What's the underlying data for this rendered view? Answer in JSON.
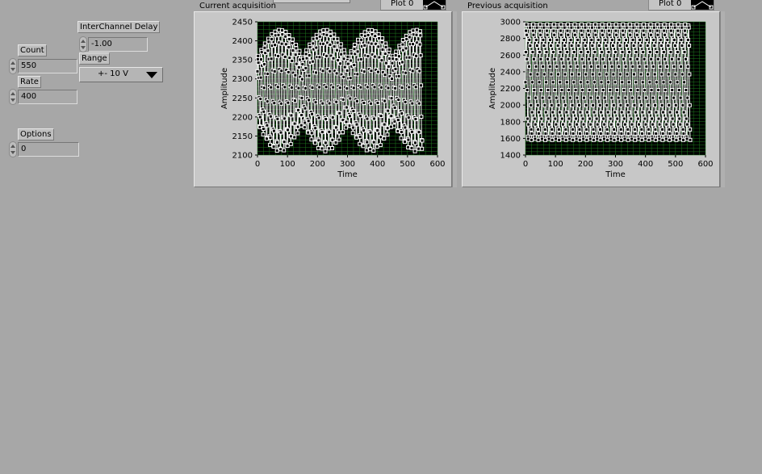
{
  "controls": {
    "interchannel_delay": {
      "label": "InterChannel Delay",
      "value": "-1.00"
    },
    "count": {
      "label": "Count",
      "value": "550"
    },
    "rate": {
      "label": "Rate",
      "value": "400"
    },
    "range": {
      "label": "Range",
      "selected": "+- 10 V"
    },
    "options": {
      "label": "Options",
      "value": "0"
    }
  },
  "graphs": [
    {
      "title": "Current acquisition",
      "legend_label": "Plot 0",
      "chart_data": {
        "type": "line",
        "xlabel": "Time",
        "ylabel": "Amplitude",
        "xlim": [
          0,
          600
        ],
        "ylim": [
          2100,
          2450
        ],
        "xticks": [
          "0",
          "100",
          "200",
          "300",
          "400",
          "500",
          "600"
        ],
        "yticks": [
          "2100",
          "2150",
          "2200",
          "2250",
          "2300",
          "2350",
          "2400",
          "2450"
        ],
        "grid": true,
        "marker": "square",
        "series": [
          {
            "x_start": 0,
            "x_end": 549,
            "n_points": 550,
            "min": 2110,
            "max": 2430,
            "pattern": "oscillating 2110–2430 with a period of about 11.5 samples"
          }
        ]
      }
    },
    {
      "title": "Previous acquisition",
      "legend_label": "Plot 0",
      "chart_data": {
        "type": "line",
        "xlabel": "Time",
        "ylabel": "Amplitude",
        "xlim": [
          0,
          600
        ],
        "ylim": [
          1400,
          3000
        ],
        "xticks": [
          "0",
          "100",
          "200",
          "300",
          "400",
          "500",
          "600"
        ],
        "yticks": [
          "1400",
          "1600",
          "1800",
          "2000",
          "2200",
          "2400",
          "2600",
          "2800",
          "3000"
        ],
        "grid": true,
        "marker": "square",
        "series": [
          {
            "x_start": 0,
            "x_end": 549,
            "n_points": 550,
            "min": 1580,
            "max": 2970,
            "pattern": "oscillating 1580–2970 with a period of about 11.5 samples"
          }
        ]
      }
    }
  ],
  "colors": {
    "background": "#a7a7a7",
    "plot_bg": "#000000",
    "grid": "#1e7a1e",
    "trace": "#ffffff"
  }
}
